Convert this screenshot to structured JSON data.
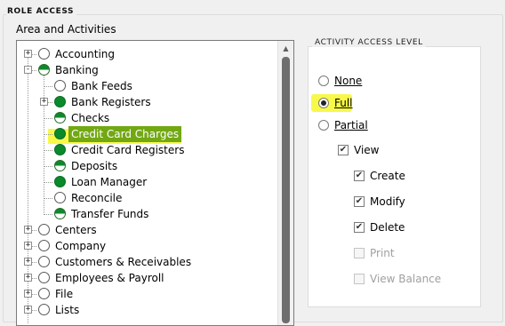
{
  "role_access": {
    "title": "ROLE ACCESS",
    "subtitle": "Area and Activities"
  },
  "tree": {
    "items": [
      {
        "label": "Accounting",
        "state": "empty",
        "expander": "+"
      },
      {
        "label": "Banking",
        "state": "half",
        "expander": "-"
      },
      {
        "label": "Bank Feeds",
        "state": "empty",
        "expander": ""
      },
      {
        "label": "Bank Registers",
        "state": "full",
        "expander": "+"
      },
      {
        "label": "Checks",
        "state": "half",
        "expander": ""
      },
      {
        "label": "Credit Card Charges",
        "state": "full",
        "expander": "",
        "selected": true
      },
      {
        "label": "Credit Card Registers",
        "state": "full",
        "expander": ""
      },
      {
        "label": "Deposits",
        "state": "half",
        "expander": ""
      },
      {
        "label": "Loan Manager",
        "state": "full",
        "expander": ""
      },
      {
        "label": "Reconcile",
        "state": "empty",
        "expander": ""
      },
      {
        "label": "Transfer Funds",
        "state": "half",
        "expander": ""
      },
      {
        "label": "Centers",
        "state": "empty",
        "expander": "+"
      },
      {
        "label": "Company",
        "state": "empty",
        "expander": "+"
      },
      {
        "label": "Customers & Receivables",
        "state": "empty",
        "expander": "+"
      },
      {
        "label": "Employees & Payroll",
        "state": "empty",
        "expander": "+"
      },
      {
        "label": "File",
        "state": "empty",
        "expander": "+"
      },
      {
        "label": "Lists",
        "state": "empty",
        "expander": "+"
      }
    ],
    "scroll_up_glyph": "▲"
  },
  "activity_level": {
    "title": "ACTIVITY ACCESS LEVEL",
    "options": {
      "none": {
        "label": "None",
        "checked": false
      },
      "full": {
        "label": "Full",
        "checked": true
      },
      "partial": {
        "label": "Partial",
        "checked": false
      }
    },
    "permissions": {
      "view": {
        "label": "View",
        "checked": true,
        "enabled": true
      },
      "create": {
        "label": "Create",
        "checked": true,
        "enabled": true
      },
      "modify": {
        "label": "Modify",
        "checked": true,
        "enabled": true
      },
      "delete": {
        "label": "Delete",
        "checked": true,
        "enabled": true
      },
      "print": {
        "label": "Print",
        "checked": false,
        "enabled": false
      },
      "view_balance": {
        "label": "View Balance",
        "checked": false,
        "enabled": false
      }
    },
    "check_glyph": "✔"
  },
  "colors": {
    "highlight": "#f7f72b",
    "selected_bg": "#72a813",
    "access_green": "#0a8a2a"
  }
}
